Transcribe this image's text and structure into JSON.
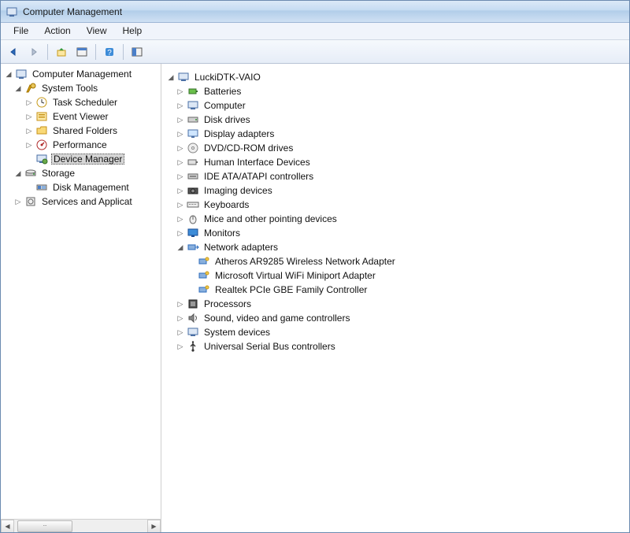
{
  "window": {
    "title": "Computer Management"
  },
  "menus": {
    "file": "File",
    "action": "Action",
    "view": "View",
    "help": "Help"
  },
  "left_tree": {
    "root": "Computer Management",
    "system_tools": {
      "label": "System Tools",
      "task_scheduler": "Task Scheduler",
      "event_viewer": "Event Viewer",
      "shared_folders": "Shared Folders",
      "performance": "Performance",
      "device_manager": "Device Manager"
    },
    "storage": {
      "label": "Storage",
      "disk_management": "Disk Management"
    },
    "services_apps": "Services and Applicat"
  },
  "right_tree": {
    "host": "LuckiDTK-VAIO",
    "batteries": "Batteries",
    "computer": "Computer",
    "disk_drives": "Disk drives",
    "display_adapters": "Display adapters",
    "dvd": "DVD/CD-ROM drives",
    "hid": "Human Interface Devices",
    "ide": "IDE ATA/ATAPI controllers",
    "imaging": "Imaging devices",
    "keyboards": "Keyboards",
    "mice": "Mice and other pointing devices",
    "monitors": "Monitors",
    "network": {
      "label": "Network adapters",
      "items": [
        "Atheros AR9285 Wireless Network Adapter",
        "Microsoft Virtual WiFi Miniport Adapter",
        "Realtek PCIe GBE Family Controller"
      ]
    },
    "processors": "Processors",
    "sound": "Sound, video and game controllers",
    "system_devices": "System devices",
    "usb": "Universal Serial Bus controllers"
  }
}
